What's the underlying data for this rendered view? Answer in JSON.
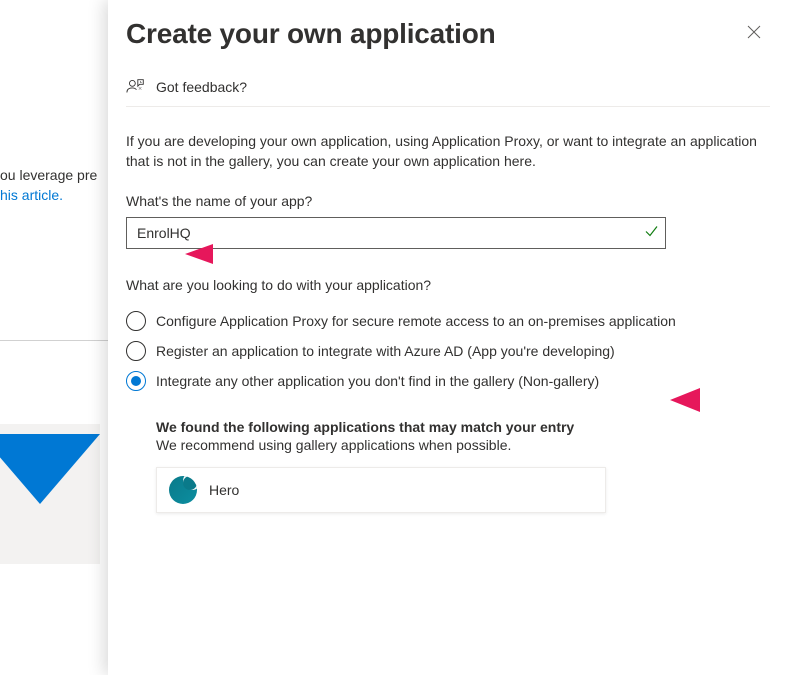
{
  "background": {
    "text_line1": "ou leverage pre",
    "link_text": "his article."
  },
  "panel": {
    "title": "Create your own application",
    "feedback_label": "Got feedback?",
    "intro": "If you are developing your own application, using Application Proxy, or want to integrate an application that is not in the gallery, you can create your own application here.",
    "name_label": "What's the name of your app?",
    "name_value": "EnrolHQ",
    "purpose_label": "What are you looking to do with your application?",
    "radios": [
      {
        "label": "Configure Application Proxy for secure remote access to an on-premises application",
        "selected": false
      },
      {
        "label": "Register an application to integrate with Azure AD (App you're developing)",
        "selected": false
      },
      {
        "label": "Integrate any other application you don't find in the gallery (Non-gallery)",
        "selected": true
      }
    ],
    "match": {
      "title": "We found the following applications that may match your entry",
      "subtitle": "We recommend using gallery applications when possible.",
      "app_name": "Hero"
    }
  },
  "colors": {
    "accent": "#0078d4",
    "annotation": "#e6175b"
  }
}
